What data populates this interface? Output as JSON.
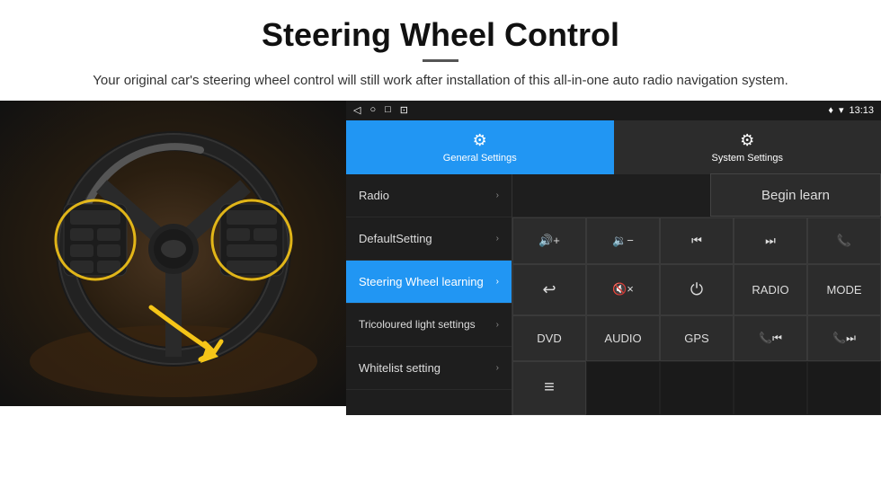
{
  "header": {
    "title": "Steering Wheel Control",
    "divider": true,
    "subtitle": "Your original car's steering wheel control will still work after installation of this all-in-one auto radio navigation system."
  },
  "status_bar": {
    "nav_back": "◁",
    "nav_home": "○",
    "nav_recent": "□",
    "nav_cast": "⊡",
    "signal_icon": "▼",
    "wifi_icon": "▾",
    "time": "13:13"
  },
  "tabs": [
    {
      "id": "general",
      "label": "General Settings",
      "icon": "⚙",
      "active": true
    },
    {
      "id": "system",
      "label": "System Settings",
      "icon": "⚙",
      "active": false
    }
  ],
  "menu_items": [
    {
      "id": "radio",
      "label": "Radio",
      "active": false
    },
    {
      "id": "default",
      "label": "DefaultSetting",
      "active": false
    },
    {
      "id": "steering",
      "label": "Steering Wheel learning",
      "active": true
    },
    {
      "id": "tricoloured",
      "label": "Tricoloured light settings",
      "active": false
    },
    {
      "id": "whitelist",
      "label": "Whitelist setting",
      "active": false
    }
  ],
  "begin_learn_label": "Begin learn",
  "control_buttons": {
    "row1": [
      {
        "id": "vol_up",
        "symbol": "🔊+",
        "label": "vol-up"
      },
      {
        "id": "vol_down",
        "symbol": "🔉−",
        "label": "vol-down"
      },
      {
        "id": "prev_track",
        "symbol": "⏮",
        "label": "prev-track"
      },
      {
        "id": "next_track",
        "symbol": "⏭",
        "label": "next-track"
      },
      {
        "id": "phone",
        "symbol": "📞",
        "label": "phone"
      }
    ],
    "row2": [
      {
        "id": "answer",
        "symbol": "↩",
        "label": "answer"
      },
      {
        "id": "mute",
        "symbol": "🔇×",
        "label": "mute"
      },
      {
        "id": "power",
        "symbol": "⏻",
        "label": "power"
      },
      {
        "id": "radio_btn",
        "symbol": "RADIO",
        "label": "radio-btn"
      },
      {
        "id": "mode",
        "symbol": "MODE",
        "label": "mode-btn"
      }
    ],
    "row3": [
      {
        "id": "dvd",
        "symbol": "DVD",
        "label": "dvd-btn"
      },
      {
        "id": "audio",
        "symbol": "AUDIO",
        "label": "audio-btn"
      },
      {
        "id": "gps",
        "symbol": "GPS",
        "label": "gps-btn"
      },
      {
        "id": "tel_prev",
        "symbol": "📞⏮",
        "label": "tel-prev"
      },
      {
        "id": "tel_next",
        "symbol": "📞⏭",
        "label": "tel-next"
      }
    ],
    "row4_single": {
      "id": "playlist",
      "symbol": "≡",
      "label": "playlist-btn"
    }
  }
}
